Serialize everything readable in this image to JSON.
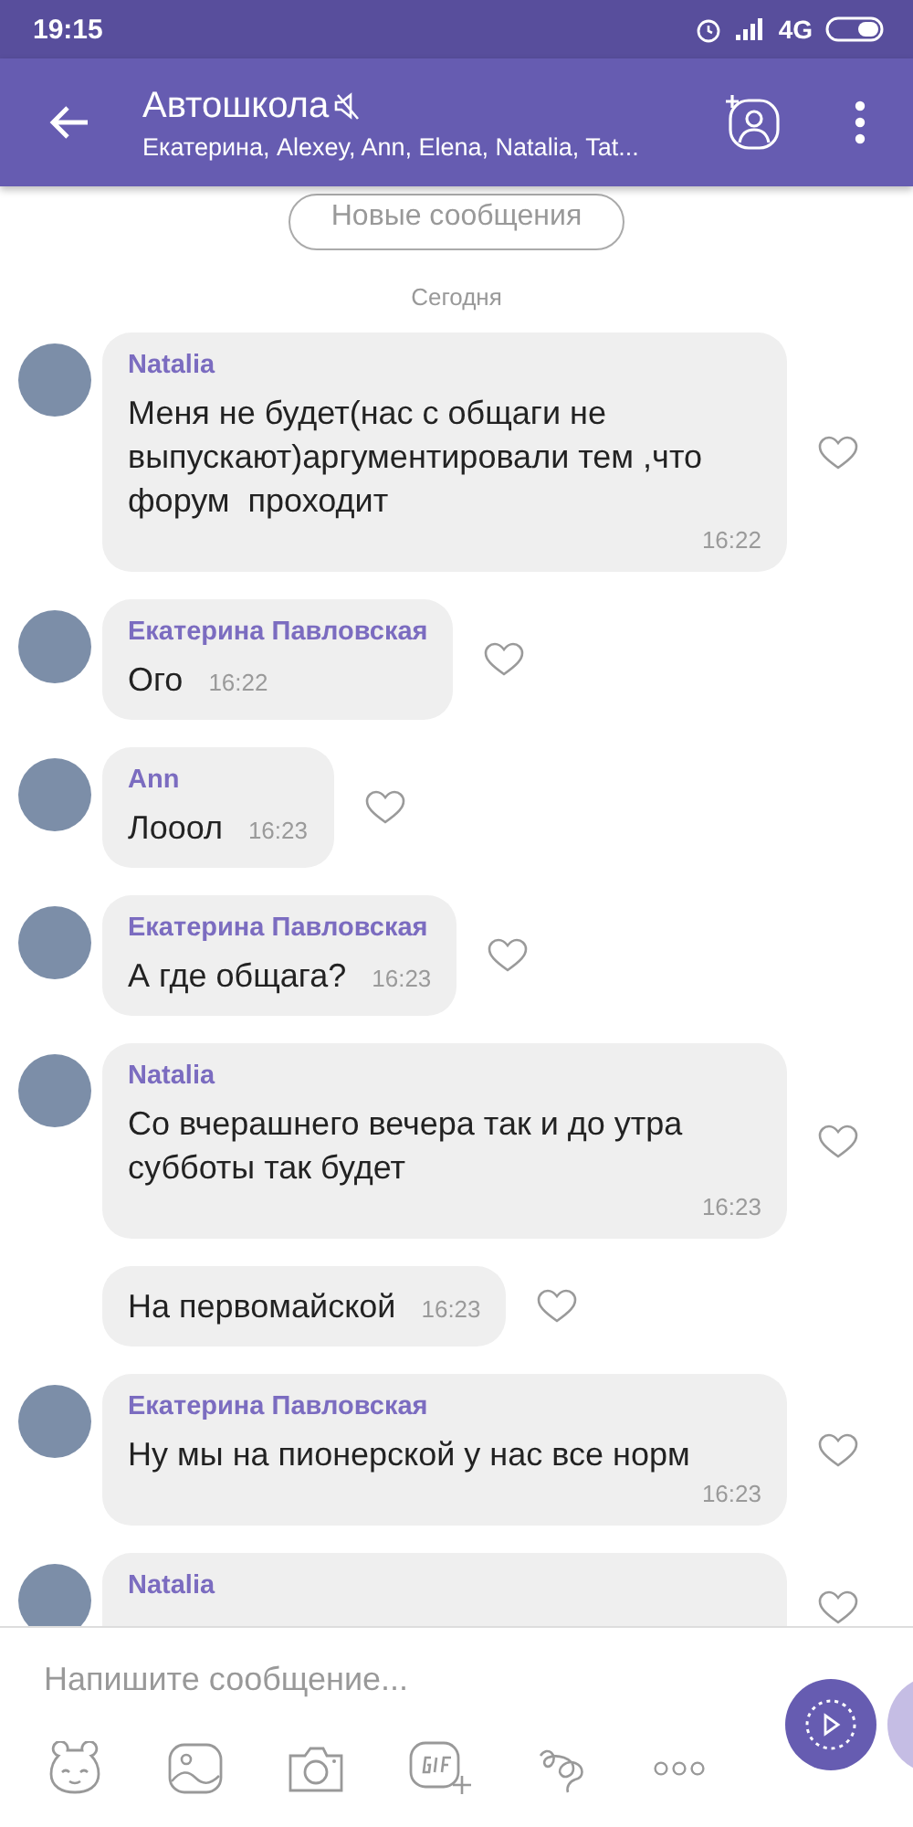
{
  "status_bar": {
    "time": "19:15",
    "network": "4G"
  },
  "header": {
    "title": "Автошкола",
    "muted": true,
    "members": "Екатерина, Alexey, Ann, Elena, Natalia, Tat..."
  },
  "new_messages_label": "Новые сообщения",
  "date_label": "Сегодня",
  "messages": [
    {
      "kind": "block",
      "sender": "Natalia",
      "text": "Меня не будет(нас с общаги не выпускают)аргументировали тем ,что  форум  проходит",
      "time": "16:22"
    },
    {
      "kind": "inline",
      "sender": "Екатерина Павловская",
      "text": "Ого",
      "time": "16:22"
    },
    {
      "kind": "inline",
      "sender": "Ann",
      "text": "Лооол",
      "time": "16:23"
    },
    {
      "kind": "inline",
      "sender": "Екатерина Павловская",
      "text": "А где общага?",
      "time": "16:23"
    },
    {
      "kind": "block",
      "sender": "Natalia",
      "text": "Со вчерашнего вечера так и до утра субботы так будет",
      "time": "16:23"
    },
    {
      "kind": "plain",
      "text": "На первомайской",
      "time": "16:23"
    },
    {
      "kind": "block",
      "sender": "Екатерина Павловская",
      "text": "Ну мы на пионерской у нас все норм",
      "time": "16:23"
    },
    {
      "kind": "cut",
      "sender": "Natalia"
    }
  ],
  "composer": {
    "placeholder": "Напишите сообщение..."
  }
}
